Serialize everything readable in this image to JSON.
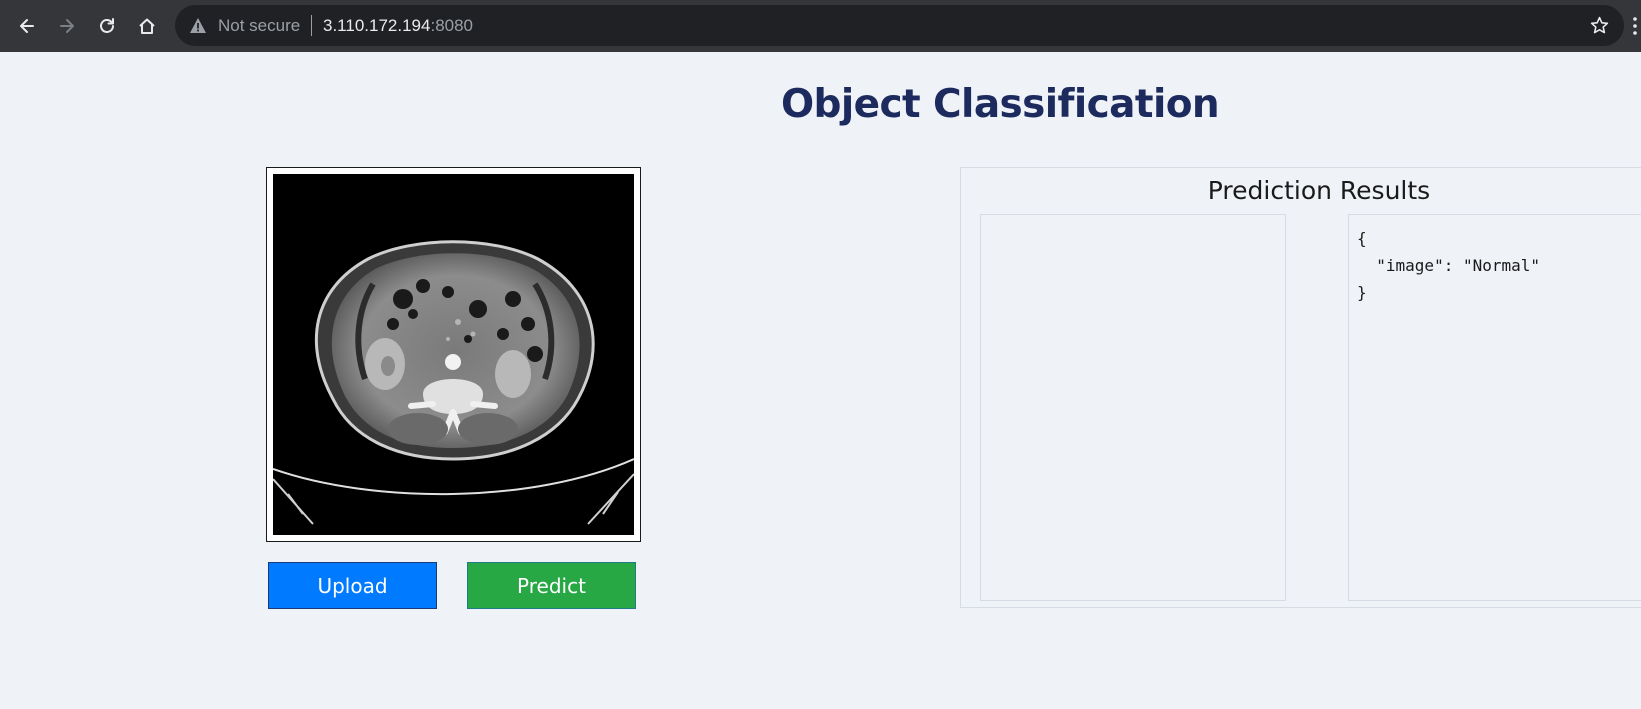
{
  "browser": {
    "security_label": "Not secure",
    "url_host": "3.110.172.194",
    "url_port": ":8080",
    "icons": [
      "back-icon",
      "forward-icon",
      "reload-icon",
      "home-icon",
      "warning-icon",
      "star-icon"
    ]
  },
  "page": {
    "title": "Object Classification"
  },
  "actions": {
    "upload_label": "Upload",
    "predict_label": "Predict"
  },
  "results": {
    "title": "Prediction Results",
    "json_text": "{\n  \"image\": \"Normal\"\n}"
  },
  "colors": {
    "title": "#1c2a5e",
    "upload": "#007bff",
    "predict": "#28a745",
    "background": "#eff2f7"
  }
}
